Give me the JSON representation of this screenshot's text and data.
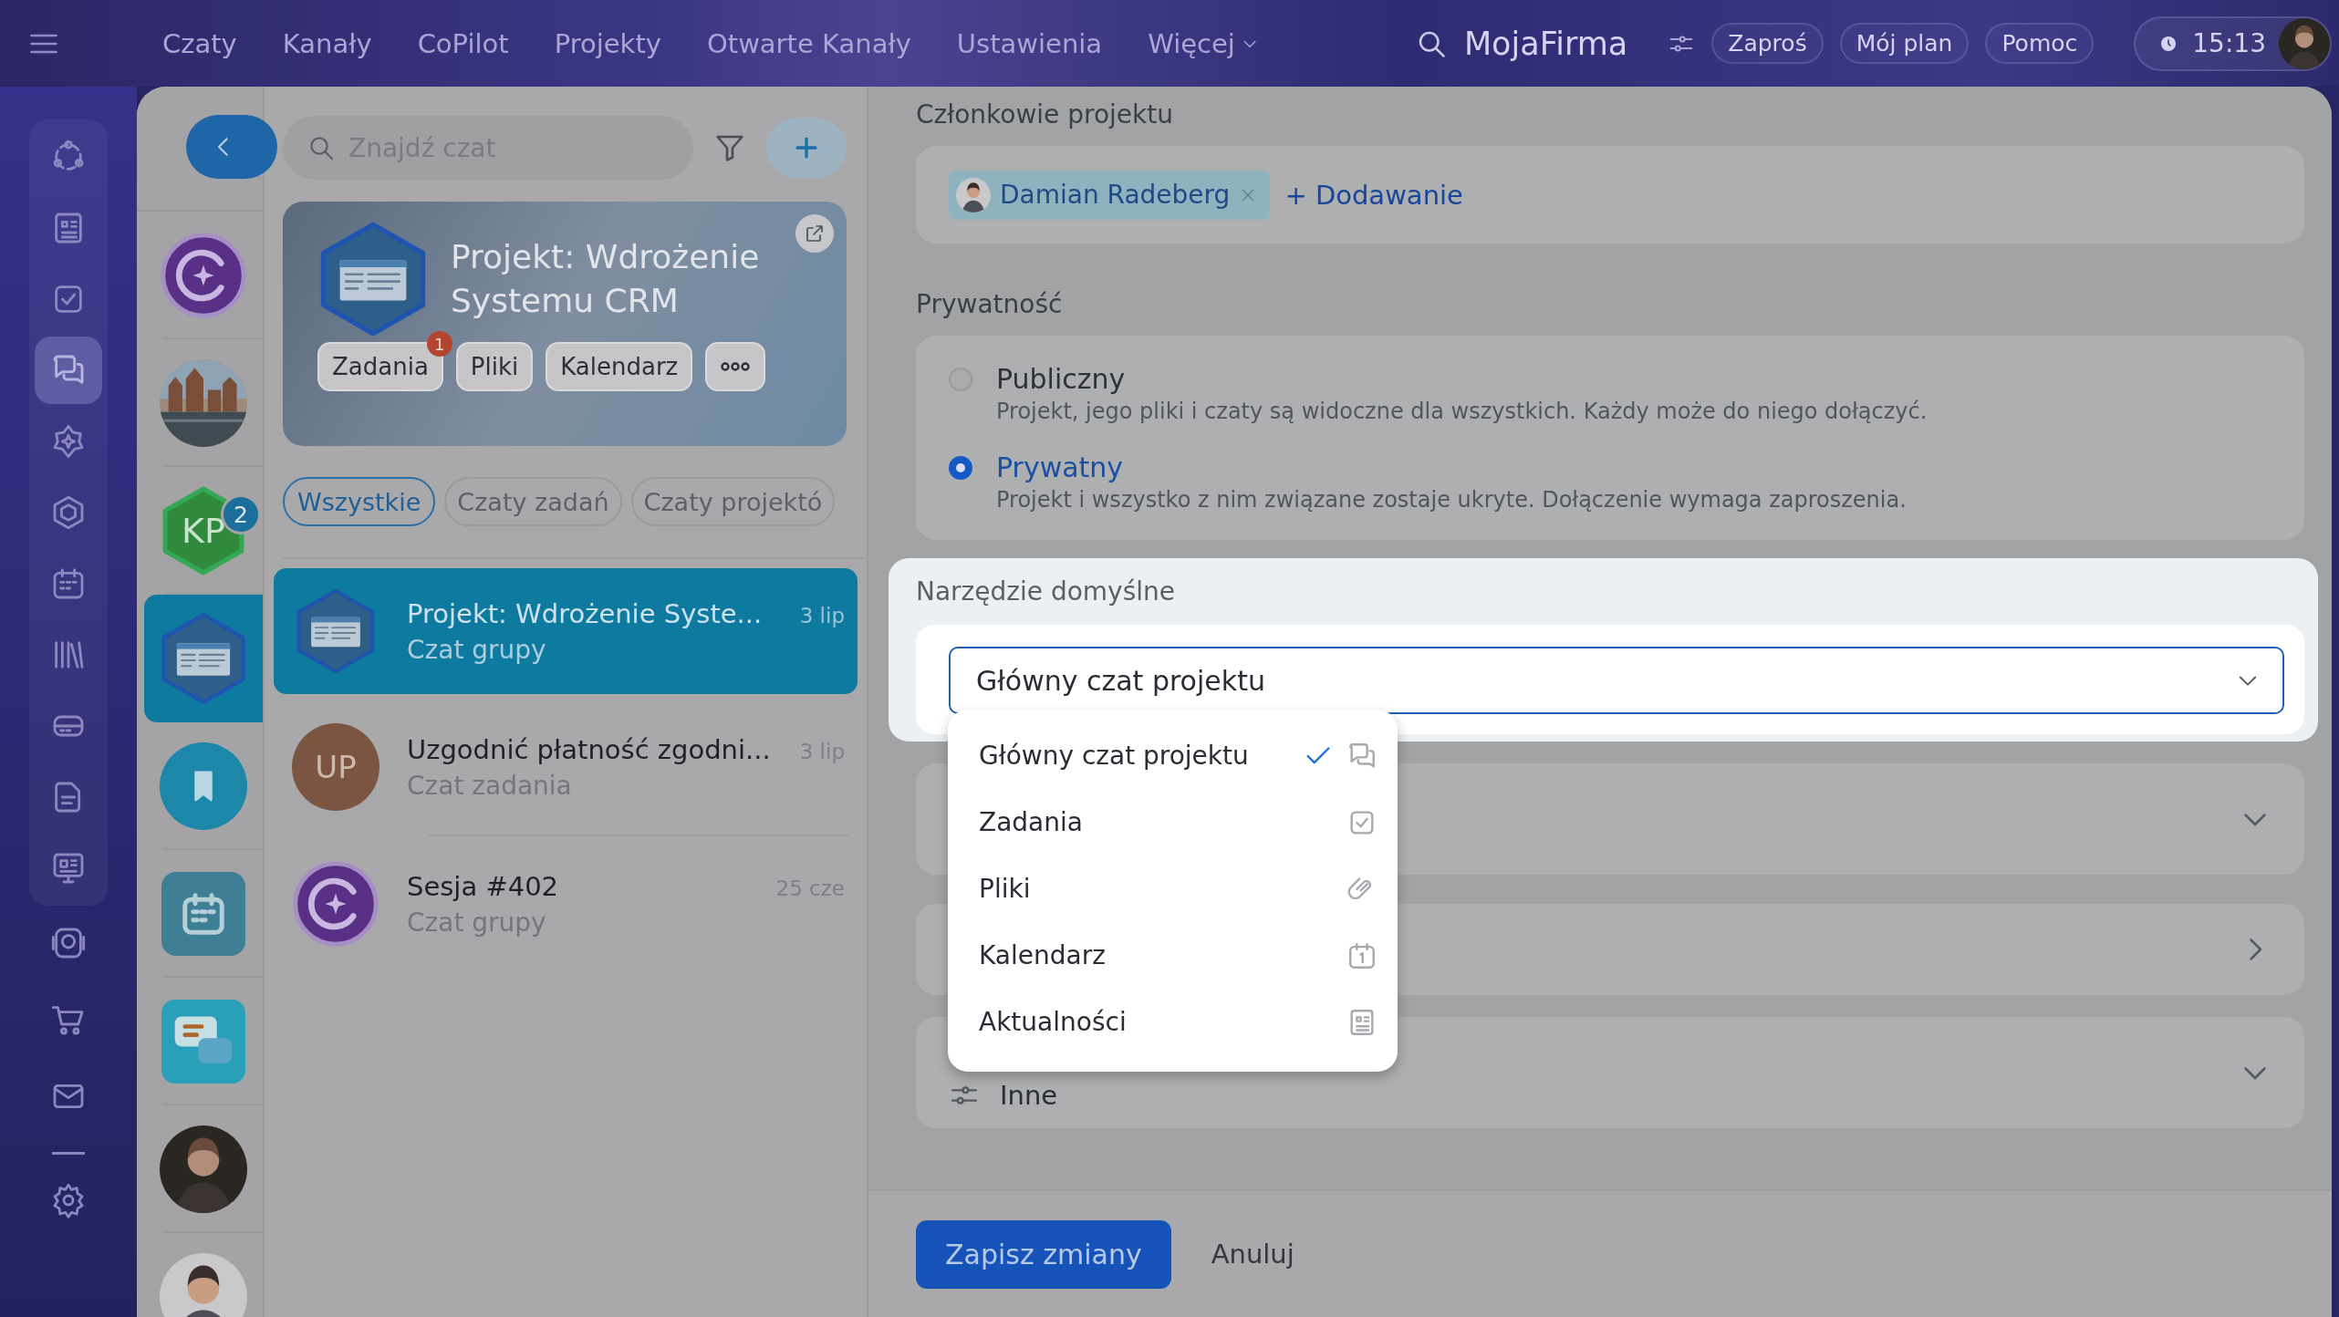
{
  "topbar": {
    "nav": [
      {
        "label": "Czaty",
        "dropdown": false
      },
      {
        "label": "Kanały",
        "dropdown": false
      },
      {
        "label": "CoPilot",
        "dropdown": false
      },
      {
        "label": "Projekty",
        "dropdown": false
      },
      {
        "label": "Otwarte Kanały",
        "dropdown": false
      },
      {
        "label": "Ustawienia",
        "dropdown": false
      },
      {
        "label": "Więcej",
        "dropdown": true
      }
    ],
    "brand": "MojaFirma",
    "buttons": [
      "Zaproś",
      "Mój plan",
      "Pomoc"
    ],
    "time": "15:13"
  },
  "rail": {
    "items": [
      {
        "selected": false
      },
      {
        "selected": false
      },
      {
        "selected": false
      },
      {
        "selected": true
      },
      {
        "selected": false
      },
      {
        "selected": false
      },
      {
        "selected": false
      },
      {
        "selected": false
      },
      {
        "selected": false
      },
      {
        "selected": false
      },
      {
        "selected": false
      },
      {
        "selected": false
      },
      {
        "selected": false
      },
      {
        "selected": false
      }
    ]
  },
  "recent": [
    {
      "kind": "copilot",
      "selected": false
    },
    {
      "kind": "picture",
      "selected": false
    },
    {
      "kind": "initials",
      "initials": "KP",
      "badge": "2",
      "selected": false
    },
    {
      "kind": "project",
      "selected": true
    },
    {
      "kind": "bookmark",
      "selected": false
    },
    {
      "kind": "calendar",
      "selected": false
    },
    {
      "kind": "chat",
      "selected": false
    },
    {
      "kind": "picture",
      "selected": false
    },
    {
      "kind": "picture",
      "selected": false
    }
  ],
  "chat_list": {
    "search": {
      "placeholder": "Znajdź czat"
    },
    "project": {
      "title": "Projekt: Wdrożenie Systemu CRM",
      "tools": [
        {
          "label": "Zadania",
          "badge": "1"
        },
        {
          "label": "Pliki"
        },
        {
          "label": "Kalendarz"
        }
      ]
    },
    "filters": [
      {
        "label": "Wszystkie",
        "selected": true
      },
      {
        "label": "Czaty zadań",
        "selected": false
      },
      {
        "label": "Czaty projektó",
        "selected": false
      }
    ],
    "chats": [
      {
        "title": "Projekt: Wdrożenie Syste...",
        "subtitle": "Czat grupy",
        "date": "3 lip",
        "kind": "project",
        "selected": true
      },
      {
        "title": "Uzgodnić płatność zgodni...",
        "subtitle": "Czat zadania",
        "date": "3 lip",
        "kind": "initials",
        "initials": "UP",
        "selected": false
      },
      {
        "title": "Sesja #402",
        "subtitle": "Czat grupy",
        "date": "25 cze",
        "kind": "copilot",
        "selected": false
      }
    ]
  },
  "settings": {
    "members": {
      "label": "Członkowie projektu",
      "people": [
        {
          "name": "Damian Radeberg"
        }
      ],
      "add": "+ Dodawanie"
    },
    "privacy": {
      "label": "Prywatność",
      "options": [
        {
          "title": "Publiczny",
          "description": "Projekt, jego pliki i czaty są widoczne dla wszystkich. Każdy może do niego dołączyć.",
          "selected": false
        },
        {
          "title": "Prywatny",
          "description": "Projekt i wszystko z nim związane zostaje ukryte. Dołączenie wymaga zaproszenia.",
          "selected": true
        }
      ]
    },
    "default_tool": {
      "label": "Narzędzie domyślne",
      "value": "Główny czat projektu",
      "expanded": true,
      "options": [
        {
          "label": "Główny czat projektu",
          "checked": true
        },
        {
          "label": "Zadania",
          "checked": false
        },
        {
          "label": "Pliki",
          "checked": false
        },
        {
          "label": "Kalendarz",
          "checked": false
        },
        {
          "label": "Aktualności",
          "checked": false
        }
      ]
    },
    "sections": [
      {
        "kind": "collapsible"
      },
      {
        "kind": "link"
      },
      {
        "label": "Inne",
        "kind": "collapsible"
      }
    ],
    "save": "Zapisz zmiany",
    "cancel": "Anuluj"
  }
}
